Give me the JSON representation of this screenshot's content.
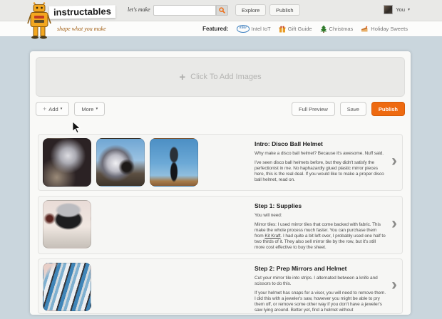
{
  "header": {
    "logo_text": "instructables",
    "tagline": "shape what you make",
    "search_label": "let's make",
    "search_value": "",
    "search_icon": "magnifier",
    "explore_label": "Explore",
    "publish_label": "Publish",
    "user_label": "You",
    "user_caret_icon": "caret-down",
    "caret_glyph": "▾",
    "robot_icon": "instructables-robot-mascot"
  },
  "featured_bar": {
    "label": "Featured:",
    "links": [
      {
        "label": "Intel IoT",
        "icon": "intel-logo",
        "intel_text": "intel"
      },
      {
        "label": "Gift Guide",
        "icon": "gift-icon"
      },
      {
        "label": "Christmas",
        "icon": "christmas-tree-icon"
      },
      {
        "label": "Holiday Sweets",
        "icon": "cake-slice-icon"
      }
    ]
  },
  "editor": {
    "dropzone": {
      "plus_glyph": "+",
      "label": "Click To Add Images"
    },
    "toolbar": {
      "add_plus_glyph": "+",
      "add_label": "Add",
      "more_label": "More",
      "full_preview_label": "Full Preview",
      "save_label": "Save",
      "publish_label": "Publish"
    }
  },
  "steps": [
    {
      "title": "Intro: Disco Ball Helmet",
      "p1": "Why make a disco ball helmet? Because it's awesome. Nuff said.",
      "p2": "I've seen disco ball helmets before, but they didn't satisfy the perfectionist in me. No haphazardly glued plastic mirror pieces here, this is the real deal. If you would like to make a proper disco ball helmet, read on.",
      "thumbnails": [
        "disco-helmet-portrait",
        "disco-helmet-golden-gate",
        "person-standing-outdoors"
      ],
      "chevron_glyph": "›"
    },
    {
      "title": "Step 1: Supplies",
      "p1": "You will need:",
      "p2_before_link": "Mirror tiles: I used mirror tiles that come backed with fabric. This make the whole process much faster. You can purchase them from ",
      "p2_link": "Kit Kraft",
      "p2_after_link": ". I had quite a bit left over, I probably used one half to two thirds of it. They also sell mirror tile by the row, but it's still more cost effective to buy the sheet.",
      "thumbnails": [
        "helmet-and-supplies-on-table"
      ],
      "chevron_glyph": "›"
    },
    {
      "title": "Step 2: Prep Mirrors and Helmet",
      "p1": "Cut your mirror tile into strips. I alternated between a knife and scissors to do this.",
      "p2": "If your helmet has snaps for a visor, you will need to remove them. I did this with a jeweler's saw, however you might be able to pry them off, or remove some other way if you don't have a jeweler's saw lying around. Better yet, find a helmet without",
      "thumbnails": [
        "mirror-tile-strips"
      ],
      "chevron_glyph": "›"
    }
  ],
  "colors": {
    "brand_orange": "#ee6a10",
    "page_background": "#cad6dd",
    "card_background": "#f9f9f7"
  }
}
